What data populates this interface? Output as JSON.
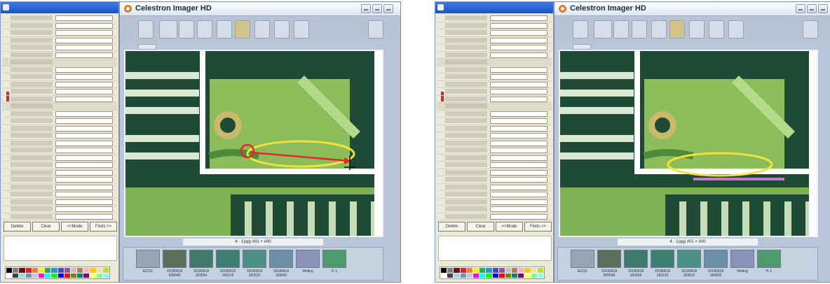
{
  "panels": [
    {
      "id": "left",
      "app_title": "Celestron Imager HD",
      "caption": "4 · 1(qq) #01 × #00",
      "thumbs": [
        "E2211",
        "20180618 005540",
        "20180618 183554",
        "20180618 183219",
        "20180618 183510",
        "20180618 184650",
        "Writing",
        "P..1"
      ],
      "buttons": [
        "Delete",
        "Clear",
        "<<Mode",
        "Finds >>"
      ],
      "has_arrow": true,
      "has_scalebar": false
    },
    {
      "id": "right",
      "app_title": "Celestron Imager HD",
      "caption": "4 · 1(qq) #01 × #00",
      "thumbs": [
        "E2211",
        "20180618 005540",
        "20180618 183554",
        "20180618 183219",
        "20180618 183510",
        "20180618 184650",
        "Writing",
        "P..1"
      ],
      "buttons": [
        "Delete",
        "Clear",
        "<<Mode",
        "Finds >>"
      ],
      "has_arrow": false,
      "has_scalebar": true
    }
  ],
  "colors": {
    "ellipse": "#f2e13a",
    "measure_arrow": "#e6262a",
    "board_green": "#8dbd5a",
    "trace_white": "#ffffff",
    "scalebar": "#c679c8"
  },
  "palette": [
    "#000000",
    "#7f7f7f",
    "#880015",
    "#ed1c24",
    "#ff7f27",
    "#fff200",
    "#22b14c",
    "#00a2e8",
    "#3f48cc",
    "#a349a4",
    "#c3c3c3",
    "#b97a57",
    "#ffaec9",
    "#ffc90e",
    "#efe4b0",
    "#b5e61d",
    "#ffffff",
    "#404040",
    "#99d9ea",
    "#7092be",
    "#c8bfe7",
    "#ff00ff",
    "#00ffff",
    "#00ff00",
    "#0000ff",
    "#ff0000",
    "#808000",
    "#008080",
    "#800080",
    "#ffff80",
    "#80ff80",
    "#80ffff"
  ]
}
